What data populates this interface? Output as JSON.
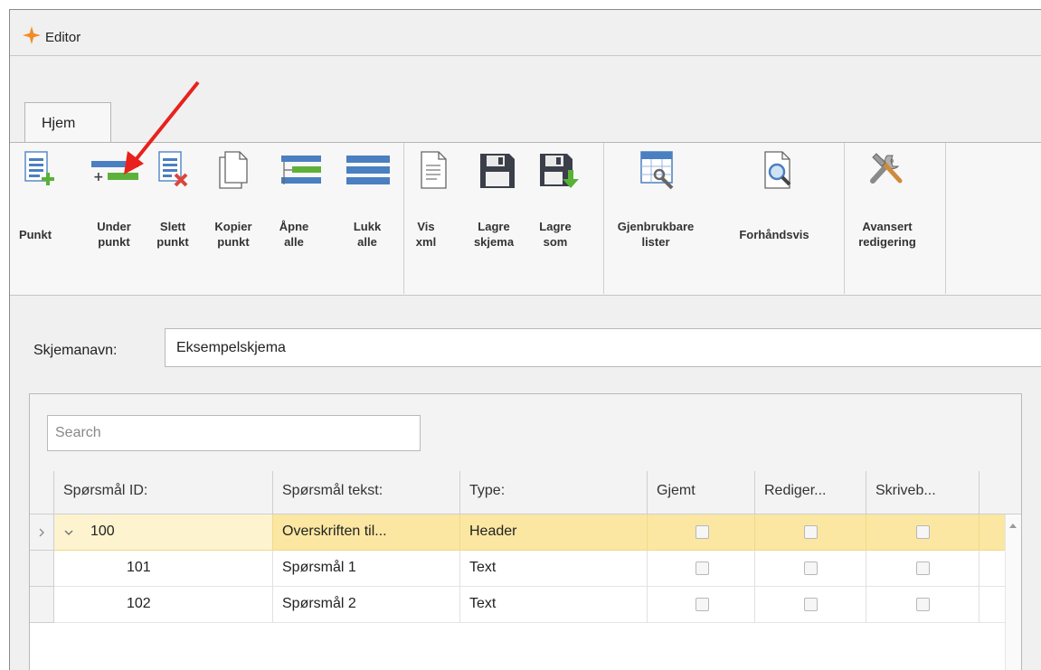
{
  "window": {
    "title": "Editor",
    "accent": "#f28c28"
  },
  "ribbon": {
    "tab": "Hjem",
    "buttons": {
      "punkt": {
        "line1": "Punkt",
        "line2": ""
      },
      "underpunkt": {
        "line1": "Under",
        "line2": "punkt"
      },
      "slett": {
        "line1": "Slett",
        "line2": "punkt"
      },
      "kopier": {
        "line1": "Kopier",
        "line2": "punkt"
      },
      "apne": {
        "line1": "Åpne",
        "line2": "alle"
      },
      "lukk": {
        "line1": "Lukk",
        "line2": "alle"
      },
      "visxml": {
        "line1": "Vis",
        "line2": "xml"
      },
      "lagreskjema": {
        "line1": "Lagre",
        "line2": "skjema"
      },
      "lagresom": {
        "line1": "Lagre",
        "line2": "som"
      },
      "gjenbruk": {
        "line1": "Gjenbrukbare",
        "line2": "lister"
      },
      "forhandsvis": {
        "line1": "Forhåndsvis",
        "line2": ""
      },
      "avansert": {
        "line1": "Avansert",
        "line2": "redigering"
      }
    },
    "icons": [
      "add-item-icon",
      "add-subitem-icon",
      "delete-item-icon",
      "copy-icon",
      "expand-all-icon",
      "collapse-all-icon",
      "xml-document-icon",
      "save-icon",
      "save-as-icon",
      "reusable-lists-icon",
      "preview-icon",
      "tools-icon"
    ],
    "annotation_color": "#e8211d"
  },
  "form": {
    "name_label": "Skjemanavn:",
    "name_value": "Eksempelskjema"
  },
  "grid": {
    "search_placeholder": "Search",
    "columns": [
      "Spørsmål ID:",
      "Spørsmål tekst:",
      "Type:",
      "Gjemt",
      "Rediger...",
      "Skriveb..."
    ],
    "rows": [
      {
        "id": "100",
        "text": "Overskriften til...",
        "type": "Header",
        "gjemt": false,
        "rediger": false,
        "skriveb": false
      },
      {
        "id": "101",
        "text": "Spørsmål 1",
        "type": "Text",
        "gjemt": false,
        "rediger": false,
        "skriveb": false
      },
      {
        "id": "102",
        "text": "Spørsmål 2",
        "type": "Text",
        "gjemt": false,
        "rediger": false,
        "skriveb": false
      }
    ],
    "header_row_color": "#fbe7a2"
  }
}
